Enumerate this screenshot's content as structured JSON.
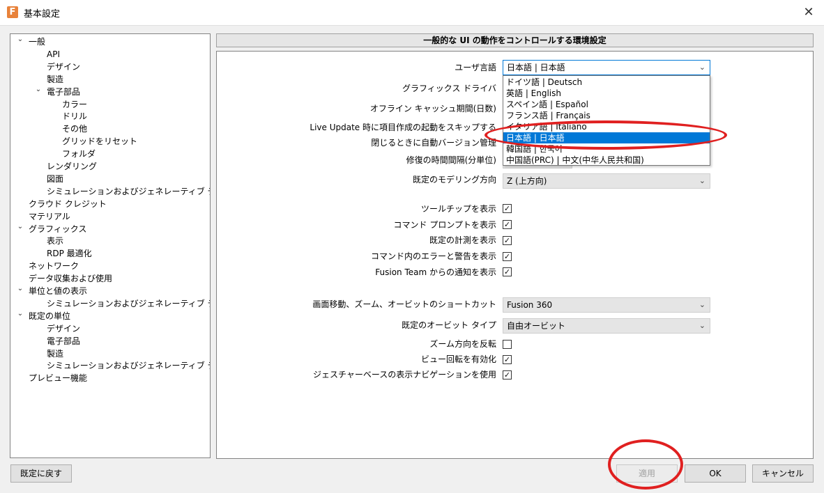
{
  "window": {
    "title": "基本設定",
    "app_icon_letter": "F",
    "close_glyph": "✕"
  },
  "tree": [
    {
      "label": "一般",
      "level": 0,
      "expanded": true
    },
    {
      "label": "API",
      "level": 2
    },
    {
      "label": "デザイン",
      "level": 2
    },
    {
      "label": "製造",
      "level": 2
    },
    {
      "label": "電子部品",
      "level": 2,
      "expanded": true
    },
    {
      "label": "カラー",
      "level": 3
    },
    {
      "label": "ドリル",
      "level": 3
    },
    {
      "label": "その他",
      "level": 3
    },
    {
      "label": "グリッドをリセット",
      "level": 3
    },
    {
      "label": "フォルダ",
      "level": 3
    },
    {
      "label": "レンダリング",
      "level": 2
    },
    {
      "label": "図面",
      "level": 2
    },
    {
      "label": "シミュレーションおよびジェネレーティブ デザイン",
      "level": 2
    },
    {
      "label": "クラウド クレジット",
      "level": 0
    },
    {
      "label": "マテリアル",
      "level": 0
    },
    {
      "label": "グラフィックス",
      "level": 0,
      "expanded": true
    },
    {
      "label": "表示",
      "level": 2
    },
    {
      "label": "RDP 最適化",
      "level": 2
    },
    {
      "label": "ネットワーク",
      "level": 0
    },
    {
      "label": "データ収集および使用",
      "level": 0
    },
    {
      "label": "単位と値の表示",
      "level": 0,
      "expanded": true
    },
    {
      "label": "シミュレーションおよびジェネレーティブ デザイン",
      "level": 2
    },
    {
      "label": "既定の単位",
      "level": 0,
      "expanded": true
    },
    {
      "label": "デザイン",
      "level": 2
    },
    {
      "label": "電子部品",
      "level": 2
    },
    {
      "label": "製造",
      "level": 2
    },
    {
      "label": "シミュレーションおよびジェネレーティブ デザイン",
      "level": 2
    },
    {
      "label": "プレビュー機能",
      "level": 0
    }
  ],
  "header": {
    "title": "一般的な UI の動作をコントロールする環境設定"
  },
  "form": {
    "user_language_label": "ユーザ言語",
    "user_language_value": "日本語 | 日本語",
    "graphics_driver_label": "グラフィックス ドライバ",
    "offline_cache_label": "オフライン キャッシュ期間(日数)",
    "live_update_label": "Live Update 時に項目作成の起動をスキップする",
    "close_version_label": "閉じるときに自動バージョン管理",
    "recovery_label": "修復の時間間隔(分単位)",
    "modeling_dir_label": "既定のモデリング方向",
    "modeling_dir_value": "Z (上方向)",
    "tooltip_label": "ツールチップを表示",
    "tooltip_checked": true,
    "cmd_prompt_label": "コマンド プロンプトを表示",
    "cmd_prompt_checked": true,
    "measure_label": "既定の計測を表示",
    "measure_checked": true,
    "cmd_errors_label": "コマンド内のエラーと警告を表示",
    "cmd_errors_checked": true,
    "fusion_team_label": "Fusion Team からの通知を表示",
    "fusion_team_checked": true,
    "shortcut_label": "画面移動、ズーム、オービットのショートカット",
    "shortcut_value": "Fusion 360",
    "orbit_label": "既定のオービット タイプ",
    "orbit_value": "自由オービット",
    "zoom_reverse_label": "ズーム方向を反転",
    "zoom_reverse_checked": false,
    "view_rotate_label": "ビュー回転を有効化",
    "view_rotate_checked": true,
    "gesture_label": "ジェスチャーベースの表示ナビゲーションを使用",
    "gesture_checked": true
  },
  "dropdown_options": [
    {
      "label": "ドイツ語 | Deutsch"
    },
    {
      "label": "英語 | English"
    },
    {
      "label": "スペイン語 | Español"
    },
    {
      "label": "フランス語 | Français"
    },
    {
      "label": "イタリア語 | Italiano"
    },
    {
      "label": "日本語 | 日本語",
      "selected": true
    },
    {
      "label": "韓国語 | 한국어"
    },
    {
      "label": "中国語(PRC) | 中文(中华人民共和国)"
    }
  ],
  "buttons": {
    "reset": "既定に戻す",
    "apply": "適用",
    "ok": "OK",
    "cancel": "キャンセル"
  },
  "colors": {
    "selection": "#0078d7",
    "annotation": "#e02020"
  },
  "icons": {
    "chevron": "⌄",
    "check": "✓",
    "dropdown_arrow": "⌄"
  }
}
